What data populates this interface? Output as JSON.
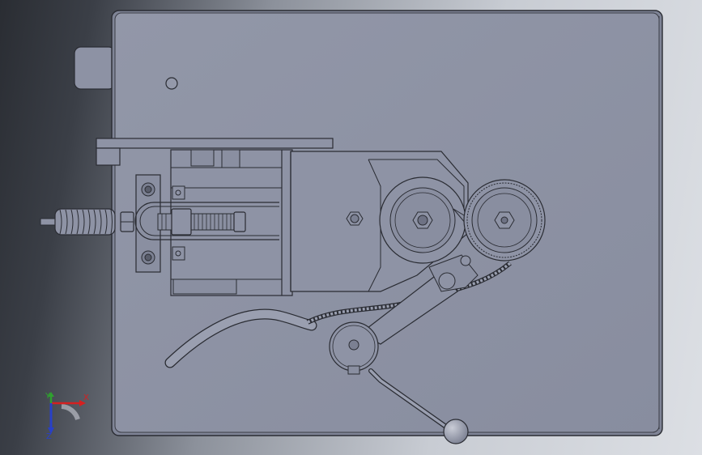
{
  "viewport": {
    "background_top": "#2a2d33",
    "background_bottom": "#dcdfe4",
    "part_color": "#8e93a5"
  },
  "model": {
    "parts": [
      "base-plate",
      "power-switch-block",
      "mounting-hole",
      "top-rail",
      "slide-block",
      "lead-screw",
      "spring",
      "gear-housing",
      "drive-wheel",
      "gear-wheel",
      "pivot-arm",
      "pulley",
      "lever-handle",
      "cable",
      "hose"
    ]
  },
  "triad": {
    "x_label": "X",
    "y_label": "Y",
    "z_label": "Z",
    "x_color": "#d52020",
    "y_color": "#2fa02f",
    "z_color": "#2840c8"
  }
}
